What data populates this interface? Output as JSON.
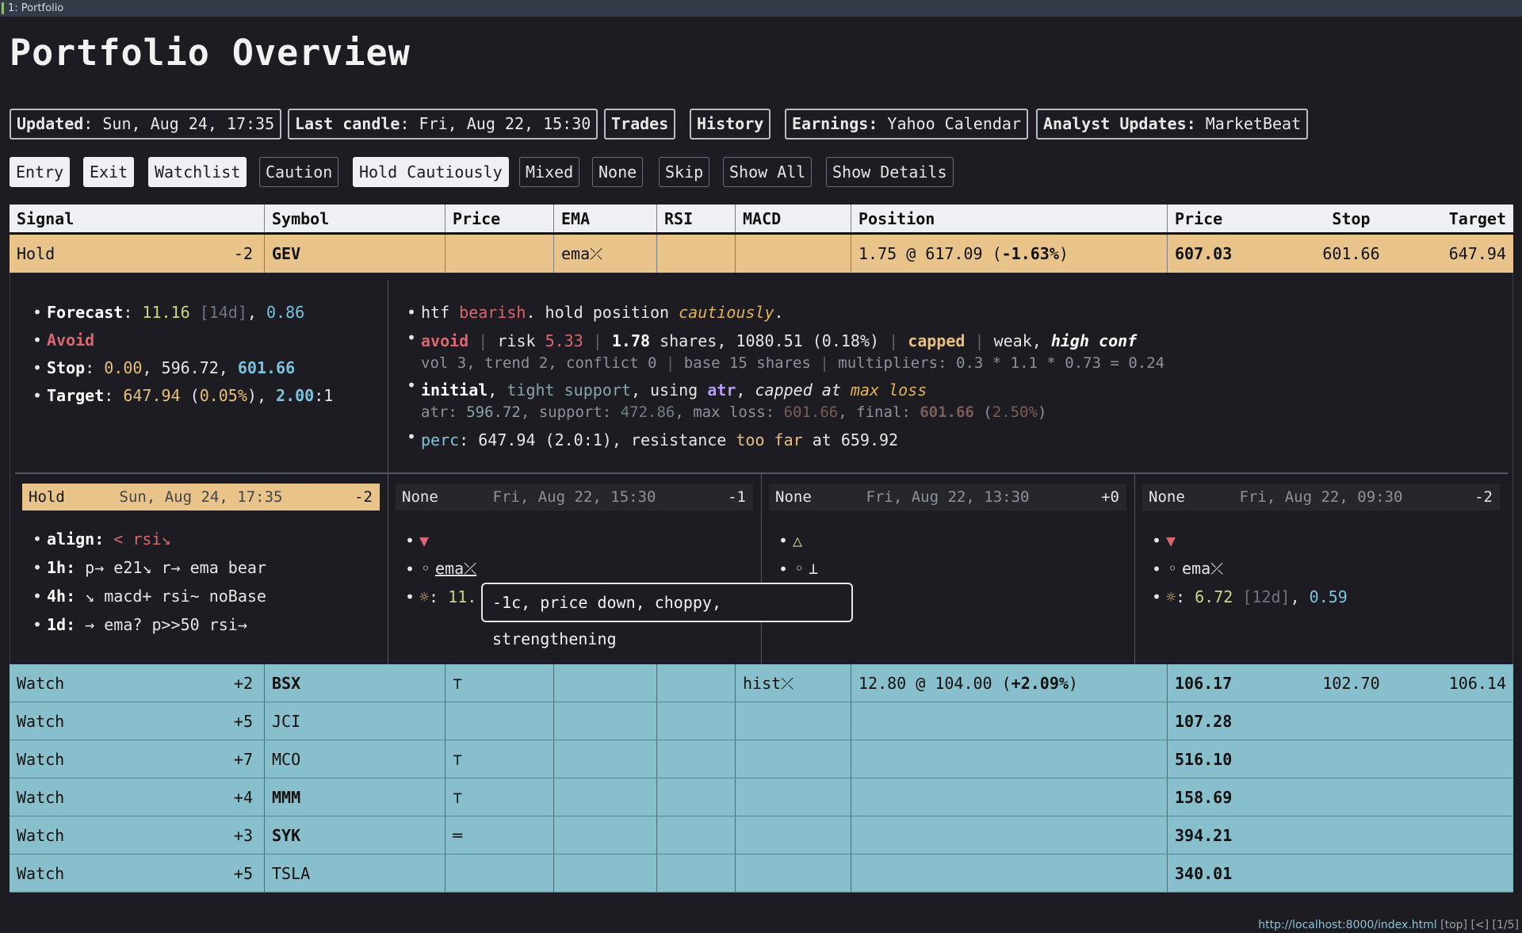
{
  "window": {
    "tab": "1: Portfolio"
  },
  "page": {
    "title": "Portfolio Overview"
  },
  "header_buttons": {
    "updated_label": "Updated",
    "updated_value": ": Sun, Aug 24, 17:35",
    "candle_label": "Last candle",
    "candle_value": ": Fri, Aug 22, 15:30",
    "trades": "Trades",
    "history": "History",
    "earnings_label": "Earnings:",
    "earnings_value": " Yahoo Calendar",
    "analyst_label": "Analyst Updates:",
    "analyst_value": " MarketBeat"
  },
  "filters": {
    "entry": "Entry",
    "exit": "Exit",
    "watchlist": "Watchlist",
    "caution": "Caution",
    "hold_cautiously": "Hold Cautiously",
    "mixed": "Mixed",
    "none": "None",
    "skip": "Skip",
    "show_all": "Show All",
    "show_details": "Show Details"
  },
  "table": {
    "headers": {
      "signal": "Signal",
      "symbol": "Symbol",
      "price": "Price",
      "ema": "EMA",
      "rsi": "RSI",
      "macd": "MACD",
      "position": "Position",
      "price2": "Price",
      "stop": "Stop",
      "target": "Target"
    },
    "gev": {
      "signal": "Hold",
      "score": "-2",
      "symbol": "GEV",
      "ema": "ema⤫",
      "pos_a": "1.75 @ 617.09 (",
      "pos_b": "-1.63%",
      "pos_c": ")",
      "price": "607.03",
      "stop": "601.66",
      "target": "647.94"
    },
    "watch_rows": [
      {
        "signal": "Watch",
        "score": "+2",
        "symbol": "BSX",
        "symbol_bold": true,
        "price_mark": "⊤",
        "macd": "hist⤫",
        "pos_a": "12.80 @ 104.00 (",
        "pos_b": "+2.09%",
        "pos_c": ")",
        "price": "106.17",
        "stop": "102.70",
        "target": "106.14"
      },
      {
        "signal": "Watch",
        "score": "+5",
        "symbol": "JCI",
        "symbol_bold": false,
        "price_mark": "",
        "macd": "",
        "pos_a": "",
        "pos_b": "",
        "pos_c": "",
        "price": "107.28",
        "stop": "",
        "target": ""
      },
      {
        "signal": "Watch",
        "score": "+7",
        "symbol": "MCO",
        "symbol_bold": false,
        "price_mark": "⊤",
        "macd": "",
        "pos_a": "",
        "pos_b": "",
        "pos_c": "",
        "price": "516.10",
        "stop": "",
        "target": ""
      },
      {
        "signal": "Watch",
        "score": "+4",
        "symbol": "MMM",
        "symbol_bold": true,
        "price_mark": "⊤",
        "macd": "",
        "pos_a": "",
        "pos_b": "",
        "pos_c": "",
        "price": "158.69",
        "stop": "",
        "target": ""
      },
      {
        "signal": "Watch",
        "score": "+3",
        "symbol": "SYK",
        "symbol_bold": true,
        "price_mark": "═",
        "macd": "",
        "pos_a": "",
        "pos_b": "",
        "pos_c": "",
        "price": "394.21",
        "stop": "",
        "target": ""
      },
      {
        "signal": "Watch",
        "score": "+5",
        "symbol": "TSLA",
        "symbol_bold": false,
        "price_mark": "",
        "macd": "",
        "pos_a": "",
        "pos_b": "",
        "pos_c": "",
        "price": "340.01",
        "stop": "",
        "target": ""
      }
    ]
  },
  "detail": {
    "forecast": {
      "label": "Forecast",
      "value": "11.16",
      "period": "[14d]",
      "conf": "0.86"
    },
    "avoid": "Avoid",
    "stop": {
      "label": "Stop",
      "v1": "0.00",
      "v2": "596.72",
      "v3": "601.66"
    },
    "target": {
      "label": "Target",
      "v1": "647.94",
      "pct": "0.05%",
      "ratio": "2.00",
      "ratio_tail": ":1"
    },
    "notes": {
      "n1_a": "htf ",
      "n1_b": "bearish",
      "n1_c": ". hold position ",
      "n1_d": "cautiously",
      "n1_e": ".",
      "n2_avoid": "avoid",
      "n2_risk_label": "risk ",
      "n2_risk": "5.33",
      "n2_shares_n": "1.78",
      "n2_shares_t": " shares, 1080.51 (0.18%)",
      "n2_capped": "capped",
      "n2_weak": "weak, ",
      "n2_conf": "high conf",
      "n2_sub": "vol 3, trend 2, conflict 0",
      "n2_sub2": "base 15 shares",
      "n2_sub3": "multipliers: 0.3 * 1.1 * 0.73 = 0.24",
      "n3_initial": "initial",
      "n3_tight": "tight support",
      "n3_using": ", using ",
      "n3_atr": "atr",
      "n3_capped": "capped at ",
      "n3_maxloss": "max loss",
      "n3_atr_l": "atr: ",
      "n3_atr_v": "596.72",
      "n3_sup_l": ", support: ",
      "n3_sup_v": "472.86",
      "n3_ml_l": ", max loss: ",
      "n3_ml_v": "601.66",
      "n3_fin_l": ", final: ",
      "n3_fin_v": "601.66",
      "n3_fin_p": "2.50%",
      "n4_perc": "perc",
      "n4_a": ": 647.94 (2.0:1), resistance ",
      "n4_far": "too far",
      "n4_b": " at 659.92"
    },
    "timeframes": [
      {
        "signal": "Hold",
        "date": "Sun, Aug 24, 17:35",
        "score": "-2"
      },
      {
        "signal": "None",
        "date": "Fri, Aug 22, 15:30",
        "score": "-1"
      },
      {
        "signal": "None",
        "date": "Fri, Aug 22, 13:30",
        "score": "+0"
      },
      {
        "signal": "None",
        "date": "Fri, Aug 22, 09:30",
        "score": "-2"
      }
    ],
    "align": {
      "align_label": "align:",
      "align_val": "< rsi↘",
      "h1_label": "1h:",
      "h1_val": "p→ e21↘ r→ ema bear",
      "h4_label": "4h:",
      "h4_val": "↘ macd+ rsi~ noBase",
      "d1_label": "1d:",
      "d1_val": "→ ema? p>>50 rsi→"
    },
    "tf2": {
      "arrow": "▼",
      "sub": "ema⤫",
      "sun": "☼",
      "forecast": "11."
    },
    "tf3": {
      "arrow": "△",
      "sub": "⊥"
    },
    "tf4": {
      "arrow": "▼",
      "sub": "ema⤫",
      "sun": "☼",
      "forecast": "6.72",
      "period": "[12d]",
      "conf": "0.59"
    }
  },
  "tooltip": "-1c, price down, choppy, strengthening",
  "statusbar": {
    "url": "http://localhost:8000/index.html",
    "rest": " [top] [<] [1/5]"
  },
  "colors": {
    "hold_row": "#e9c48a",
    "watch_row": "#88bfcc",
    "background": "#1c1c22"
  }
}
